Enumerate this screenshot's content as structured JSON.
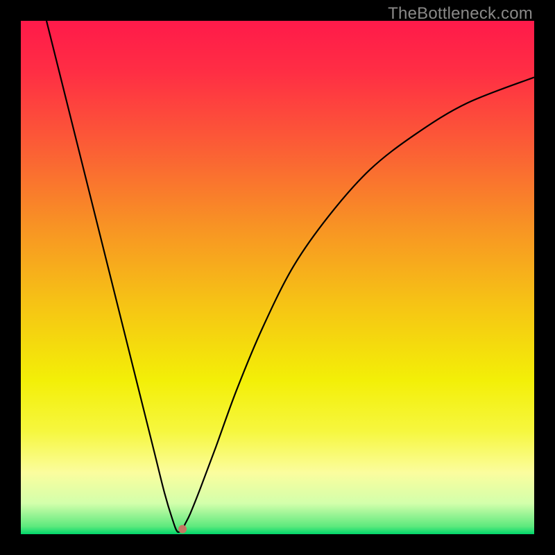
{
  "watermark": "TheBottleneck.com",
  "colors": {
    "background": "#000000",
    "curve": "#000000",
    "marker": "#c47762",
    "watermark": "#8a8988"
  },
  "chart_data": {
    "type": "line",
    "title": "",
    "xlabel": "",
    "ylabel": "",
    "xlim": [
      0,
      100
    ],
    "ylim": [
      0,
      100
    ],
    "gradient_stops": [
      {
        "offset": 0.0,
        "color": "#ff1a4a"
      },
      {
        "offset": 0.1,
        "color": "#ff2e44"
      },
      {
        "offset": 0.25,
        "color": "#fb5f35"
      },
      {
        "offset": 0.4,
        "color": "#f89324"
      },
      {
        "offset": 0.55,
        "color": "#f6c315"
      },
      {
        "offset": 0.7,
        "color": "#f3ef07"
      },
      {
        "offset": 0.8,
        "color": "#f6f73f"
      },
      {
        "offset": 0.88,
        "color": "#fbfd9e"
      },
      {
        "offset": 0.94,
        "color": "#d3ffab"
      },
      {
        "offset": 0.985,
        "color": "#5de97d"
      },
      {
        "offset": 1.0,
        "color": "#00d66a"
      }
    ],
    "series": [
      {
        "name": "bottleneck-curve",
        "x": [
          5,
          8,
          11,
          14,
          17,
          20,
          23,
          26,
          28,
          29.5,
          30.5,
          31.5,
          32,
          33,
          35,
          38,
          42,
          47,
          53,
          60,
          68,
          77,
          87,
          100
        ],
        "y": [
          100,
          88,
          76,
          64,
          52,
          40,
          28,
          16,
          8,
          3,
          0.5,
          1,
          2,
          4,
          9,
          17,
          28,
          40,
          52,
          62,
          71,
          78,
          84,
          89
        ]
      }
    ],
    "marker": {
      "x": 31.5,
      "y": 1
    },
    "annotations": []
  }
}
